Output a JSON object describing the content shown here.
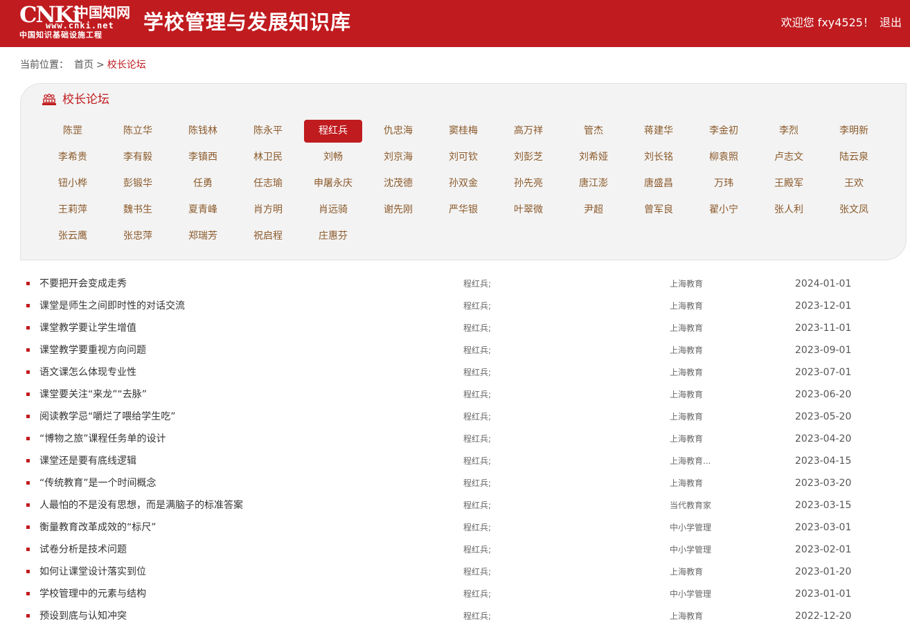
{
  "header": {
    "logo_mark": "CNKi",
    "logo_cn": "中国知网",
    "logo_url": "www.cnki.net",
    "logo_sub": "中国知识基础设施工程",
    "site_title": "学校管理与发展知识库",
    "welcome": "欢迎您 fxy4525！",
    "logout": "退出"
  },
  "breadcrumb": {
    "label": "当前位置：",
    "home": "首页",
    "separator": ">",
    "current": "校长论坛"
  },
  "panel": {
    "title": "校长论坛",
    "names": [
      "陈罡",
      "陈立华",
      "陈钱林",
      "陈永平",
      "程红兵",
      "仇忠海",
      "窦桂梅",
      "高万祥",
      "管杰",
      "蒋建华",
      "李金初",
      "李烈",
      "李明新",
      "李希贵",
      "李有毅",
      "李镇西",
      "林卫民",
      "刘畅",
      "刘京海",
      "刘可钦",
      "刘彭芝",
      "刘希娅",
      "刘长铭",
      "柳袁照",
      "卢志文",
      "陆云泉",
      "钮小桦",
      "彭锻华",
      "任勇",
      "任志瑜",
      "申屠永庆",
      "沈茂德",
      "孙双金",
      "孙先亮",
      "唐江澎",
      "唐盛昌",
      "万玮",
      "王殿军",
      "王欢",
      "王莉萍",
      "魏书生",
      "夏青峰",
      "肖方明",
      "肖远骑",
      "谢先刚",
      "严华银",
      "叶翠微",
      "尹超",
      "曾军良",
      "翟小宁",
      "张人利",
      "张文凤",
      "张云鹰",
      "张忠萍",
      "郑瑞芳",
      "祝启程",
      "庄惠芬"
    ],
    "active_index": 4
  },
  "articles": [
    {
      "title": "不要把开会变成走秀",
      "author": "程红兵;",
      "source": "上海教育",
      "date": "2024-01-01"
    },
    {
      "title": "课堂是师生之间即时性的对话交流",
      "author": "程红兵;",
      "source": "上海教育",
      "date": "2023-12-01"
    },
    {
      "title": "课堂教学要让学生增值",
      "author": "程红兵;",
      "source": "上海教育",
      "date": "2023-11-01"
    },
    {
      "title": "课堂教学要重视方向问题",
      "author": "程红兵;",
      "source": "上海教育",
      "date": "2023-09-01"
    },
    {
      "title": "语文课怎么体现专业性",
      "author": "程红兵;",
      "source": "上海教育",
      "date": "2023-07-01"
    },
    {
      "title": "课堂要关注“来龙”“去脉”",
      "author": "程红兵;",
      "source": "上海教育",
      "date": "2023-06-20"
    },
    {
      "title": "阅读教学忌“嚼烂了喂给学生吃”",
      "author": "程红兵;",
      "source": "上海教育",
      "date": "2023-05-20"
    },
    {
      "title": "“博物之旅”课程任务单的设计",
      "author": "程红兵;",
      "source": "上海教育",
      "date": "2023-04-20"
    },
    {
      "title": "课堂还是要有底线逻辑",
      "author": "程红兵;",
      "source": "上海教育...",
      "date": "2023-04-15"
    },
    {
      "title": "“传统教育”是一个时间概念",
      "author": "程红兵;",
      "source": "上海教育",
      "date": "2023-03-20"
    },
    {
      "title": "人最怕的不是没有思想，而是满脑子的标准答案",
      "author": "程红兵;",
      "source": "当代教育家",
      "date": "2023-03-15"
    },
    {
      "title": "衡量教育改革成效的“标尺”",
      "author": "程红兵;",
      "source": "中小学管理",
      "date": "2023-03-01"
    },
    {
      "title": "试卷分析是技术问题",
      "author": "程红兵;",
      "source": "中小学管理",
      "date": "2023-02-01"
    },
    {
      "title": "如何让课堂设计落实到位",
      "author": "程红兵;",
      "source": "上海教育",
      "date": "2023-01-20"
    },
    {
      "title": "学校管理中的元素与结构",
      "author": "程红兵;",
      "source": "中小学管理",
      "date": "2023-01-01"
    },
    {
      "title": "预设到底与认知冲突",
      "author": "程红兵;",
      "source": "上海教育",
      "date": "2022-12-20"
    }
  ]
}
